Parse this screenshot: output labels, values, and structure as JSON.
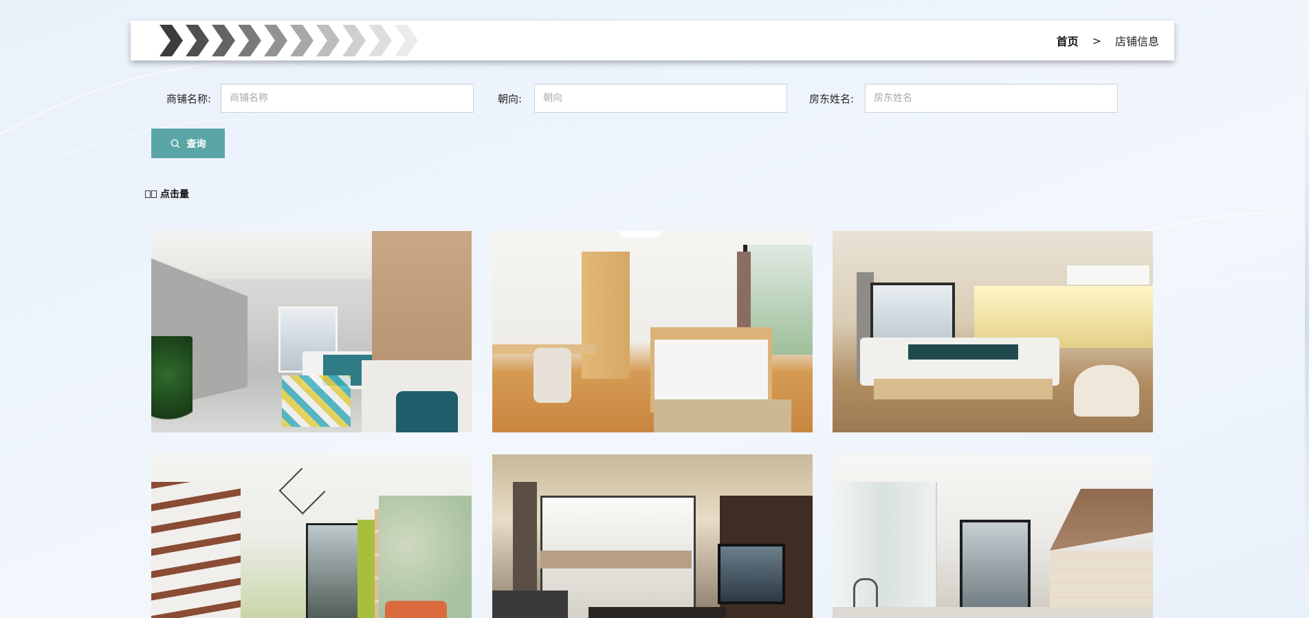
{
  "breadcrumb": {
    "home": "首页",
    "separator": ">",
    "current": "店铺信息"
  },
  "search": {
    "fields": [
      {
        "label": "商铺名称:",
        "placeholder": "商铺名称",
        "value": ""
      },
      {
        "label": "朝向:",
        "placeholder": "朝向",
        "value": ""
      },
      {
        "label": "房东姓名:",
        "placeholder": "房东姓名",
        "value": ""
      }
    ],
    "button_label": "查询"
  },
  "sort": {
    "label": "点击量"
  },
  "gallery": {
    "items": [
      {
        "icon": "room-photo-1"
      },
      {
        "icon": "room-photo-2"
      },
      {
        "icon": "room-photo-3"
      },
      {
        "icon": "room-photo-4"
      },
      {
        "icon": "room-photo-5"
      },
      {
        "icon": "room-photo-6"
      }
    ]
  },
  "colors": {
    "button_bg": "#5aa6a6",
    "page_bg": "#eef4fc",
    "header_bg": "#ffffff"
  }
}
